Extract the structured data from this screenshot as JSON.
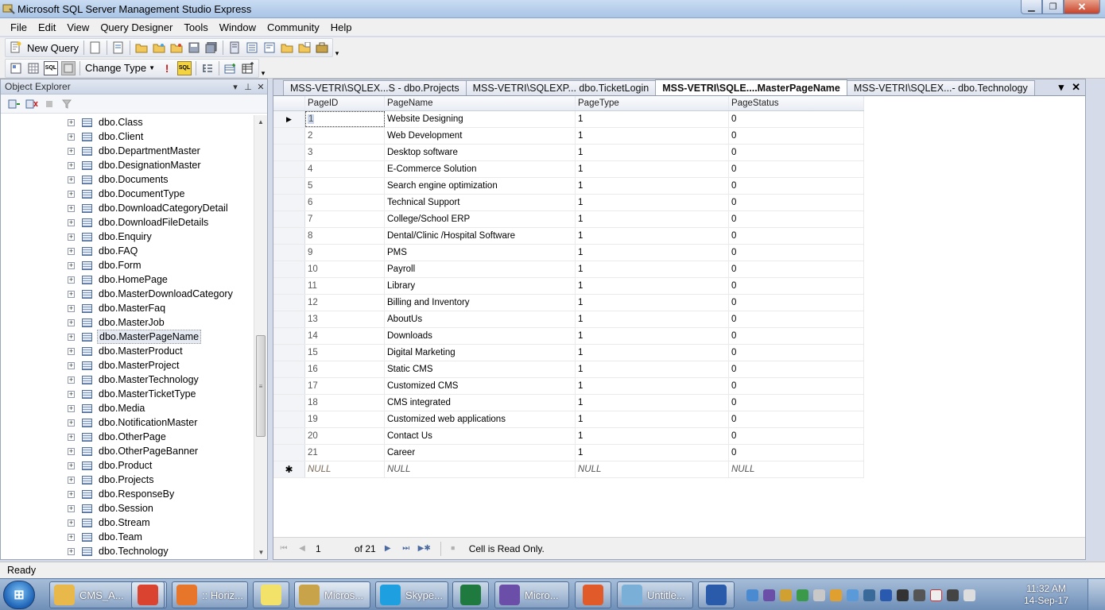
{
  "window": {
    "title": "Microsoft SQL Server Management Studio Express"
  },
  "menu": [
    "File",
    "Edit",
    "View",
    "Query Designer",
    "Tools",
    "Window",
    "Community",
    "Help"
  ],
  "toolbar": {
    "new_query": "New Query",
    "change_type": "Change Type"
  },
  "object_explorer": {
    "title": "Object Explorer",
    "items": [
      {
        "label": "dbo.Class"
      },
      {
        "label": "dbo.Client"
      },
      {
        "label": "dbo.DepartmentMaster"
      },
      {
        "label": "dbo.DesignationMaster"
      },
      {
        "label": "dbo.Documents"
      },
      {
        "label": "dbo.DocumentType"
      },
      {
        "label": "dbo.DownloadCategoryDetail"
      },
      {
        "label": "dbo.DownloadFileDetails"
      },
      {
        "label": "dbo.Enquiry"
      },
      {
        "label": "dbo.FAQ"
      },
      {
        "label": "dbo.Form"
      },
      {
        "label": "dbo.HomePage"
      },
      {
        "label": "dbo.MasterDownloadCategory"
      },
      {
        "label": "dbo.MasterFaq"
      },
      {
        "label": "dbo.MasterJob"
      },
      {
        "label": "dbo.MasterPageName",
        "selected": true
      },
      {
        "label": "dbo.MasterProduct"
      },
      {
        "label": "dbo.MasterProject"
      },
      {
        "label": "dbo.MasterTechnology"
      },
      {
        "label": "dbo.MasterTicketType"
      },
      {
        "label": "dbo.Media"
      },
      {
        "label": "dbo.NotificationMaster"
      },
      {
        "label": "dbo.OtherPage"
      },
      {
        "label": "dbo.OtherPageBanner"
      },
      {
        "label": "dbo.Product"
      },
      {
        "label": "dbo.Projects"
      },
      {
        "label": "dbo.ResponseBy"
      },
      {
        "label": "dbo.Session"
      },
      {
        "label": "dbo.Stream"
      },
      {
        "label": "dbo.Team"
      },
      {
        "label": "dbo.Technology"
      }
    ]
  },
  "tabs": [
    {
      "label": "MSS-VETRI\\SQLEX...S - dbo.Projects",
      "active": false
    },
    {
      "label": "MSS-VETRI\\SQLEXP... dbo.TicketLogin",
      "active": false
    },
    {
      "label": "MSS-VETRI\\SQLE....MasterPageName",
      "active": true
    },
    {
      "label": "MSS-VETRI\\SQLEX...- dbo.Technology",
      "active": false
    }
  ],
  "grid": {
    "columns": [
      "PageID",
      "PageName",
      "PageType",
      "PageStatus"
    ],
    "rows": [
      [
        "1",
        "Website Designing",
        "1",
        "0"
      ],
      [
        "2",
        "Web Development",
        "1",
        "0"
      ],
      [
        "3",
        "Desktop software",
        "1",
        "0"
      ],
      [
        "4",
        "E-Commerce Solution",
        "1",
        "0"
      ],
      [
        "5",
        "Search engine optimization",
        "1",
        "0"
      ],
      [
        "6",
        "Technical Support",
        "1",
        "0"
      ],
      [
        "7",
        "College/School ERP",
        "1",
        "0"
      ],
      [
        "8",
        "Dental/Clinic /Hospital Software",
        "1",
        "0"
      ],
      [
        "9",
        "PMS",
        "1",
        "0"
      ],
      [
        "10",
        "Payroll",
        "1",
        "0"
      ],
      [
        "11",
        "Library",
        "1",
        "0"
      ],
      [
        "12",
        "Billing and Inventory",
        "1",
        "0"
      ],
      [
        "13",
        "AboutUs",
        "1",
        "0"
      ],
      [
        "14",
        "Downloads",
        "1",
        "0"
      ],
      [
        "15",
        "Digital Marketing",
        "1",
        "0"
      ],
      [
        "16",
        "Static CMS",
        "1",
        "0"
      ],
      [
        "17",
        "Customized CMS",
        "1",
        "0"
      ],
      [
        "18",
        "CMS integrated",
        "1",
        "0"
      ],
      [
        "19",
        "Customized web applications",
        "1",
        "0"
      ],
      [
        "20",
        "Contact Us",
        "1",
        "0"
      ],
      [
        "21",
        "Career",
        "1",
        "0"
      ]
    ],
    "null_text": "NULL"
  },
  "navigator": {
    "current": "1",
    "of_text": "of 21",
    "status": "Cell is Read Only."
  },
  "statusbar": {
    "text": "Ready"
  },
  "taskbar": {
    "items": [
      {
        "label": "CMS_A...",
        "icon": "folder-icon",
        "color": "#e8b84a"
      },
      {
        "label": "",
        "icon": "chrome-icon",
        "color": "#d9432f"
      },
      {
        "label": ":: Horiz...",
        "icon": "firefox-icon",
        "color": "#e8762a"
      },
      {
        "label": "",
        "icon": "sticky-notes-icon",
        "color": "#f3e26a"
      },
      {
        "label": "Micros...",
        "icon": "ssms-icon",
        "color": "#c9a34a"
      },
      {
        "label": "Skype...",
        "icon": "skype-icon",
        "color": "#1ea0e0"
      },
      {
        "label": "",
        "icon": "excel-icon",
        "color": "#1e7a3e"
      },
      {
        "label": "Micro...",
        "icon": "visual-studio-icon",
        "color": "#6a4ea8"
      },
      {
        "label": "",
        "icon": "vs-installer-icon",
        "color": "#e05a2a"
      },
      {
        "label": "Untitle...",
        "icon": "paint-icon",
        "color": "#7ab0d8"
      },
      {
        "label": "",
        "icon": "word-icon",
        "color": "#2a5bab"
      }
    ],
    "time": "11:32 AM",
    "date": "14-Sep-17"
  }
}
